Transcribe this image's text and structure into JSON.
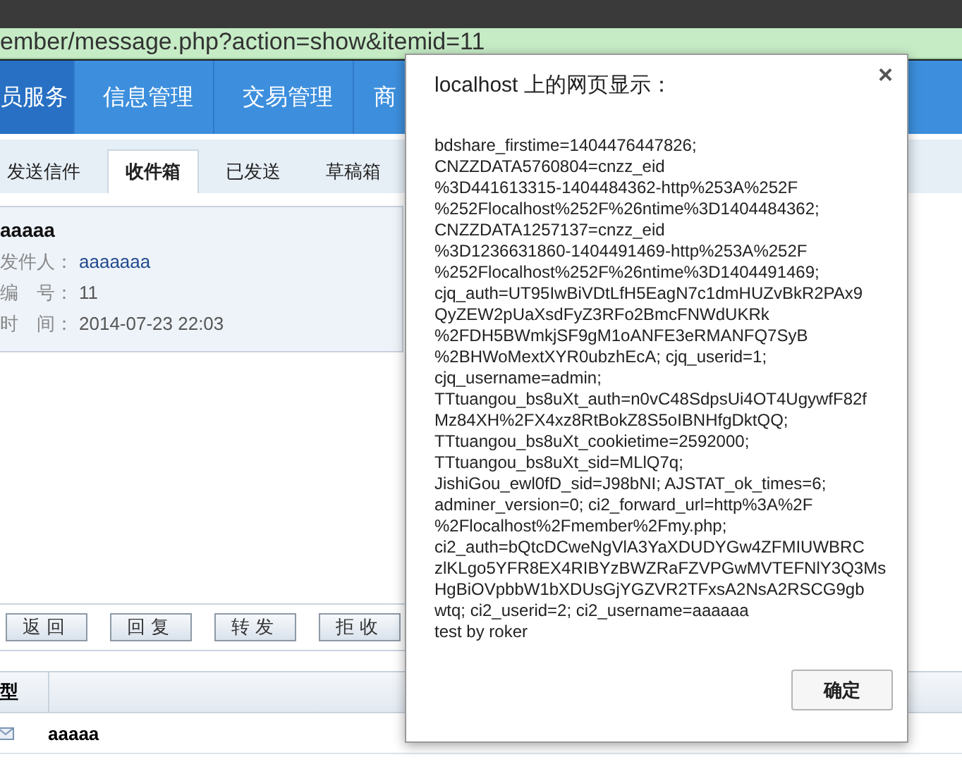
{
  "address_bar": {
    "url": "ember/message.php?action=show&itemid=11"
  },
  "nav": [
    {
      "label": "员服务",
      "selected": true
    },
    {
      "label": "信息管理",
      "selected": false
    },
    {
      "label": "交易管理",
      "selected": false
    },
    {
      "label": "商",
      "selected": false
    }
  ],
  "tabs": [
    {
      "label": "发送信件",
      "selected": false
    },
    {
      "label": "收件箱",
      "selected": true
    },
    {
      "label": "已发送",
      "selected": false
    },
    {
      "label": "草稿箱",
      "selected": false
    }
  ],
  "message": {
    "title": "aaaaa",
    "fields": [
      {
        "label": "发件人：",
        "value": "aaaaaaa",
        "kind": "link"
      },
      {
        "label": "编　号：",
        "value": "11",
        "kind": "text"
      },
      {
        "label": "时　间：",
        "value": "2014-07-23 22:03",
        "kind": "text"
      }
    ]
  },
  "buttons": [
    "返回",
    "回复",
    "转发",
    "拒收"
  ],
  "table": {
    "columns": [
      "型"
    ],
    "rows": [
      {
        "title": "aaaaa"
      }
    ]
  },
  "dialog": {
    "title": "localhost 上的网页显示：",
    "close": "×",
    "lines": [
      "bdshare_firstime=1404476447826;",
      "CNZZDATA5760804=cnzz_eid",
      "%3D441613315-1404484362-http%253A%252F",
      "%252Flocalhost%252F%26ntime%3D1404484362;",
      "CNZZDATA1257137=cnzz_eid",
      "%3D1236631860-1404491469-http%253A%252F",
      "%252Flocalhost%252F%26ntime%3D1404491469;",
      "cjq_auth=UT95IwBiVDtLfH5EagN7c1dmHUZvBkR2PAx9",
      "QyZEW2pUaXsdFyZ3RFo2BmcFNWdUKRk",
      "%2FDH5BWmkjSF9gM1oANFE3eRMANFQ7SyB",
      "%2BHWoMextXYR0ubzhEcA; cjq_userid=1;",
      "cjq_username=admin;",
      "TTtuangou_bs8uXt_auth=n0vC48SdpsUi4OT4UgywfF82f",
      "Mz84XH%2FX4xz8RtBokZ8S5oIBNHfgDktQQ;",
      "TTtuangou_bs8uXt_cookietime=2592000;",
      "TTtuangou_bs8uXt_sid=MLlQ7q;",
      "JishiGou_ewl0fD_sid=J98bNI; AJSTAT_ok_times=6;",
      "adminer_version=0; ci2_forward_url=http%3A%2F",
      "%2Flocalhost%2Fmember%2Fmy.php;",
      "ci2_auth=bQtcDCweNgVlA3YaXDUDYGw4ZFMIUWBRC",
      "zlKLgo5YFR8EX4RIBYzBWZRaFZVPGwMVTEFNlY3Q3Ms",
      "HgBiOVpbbW1bXDUsGjYGZVR2TFxsA2NsA2RSCG9gb",
      "wtq; ci2_userid=2; ci2_username=aaaaaa",
      "test by roker"
    ],
    "ok": "确定"
  }
}
